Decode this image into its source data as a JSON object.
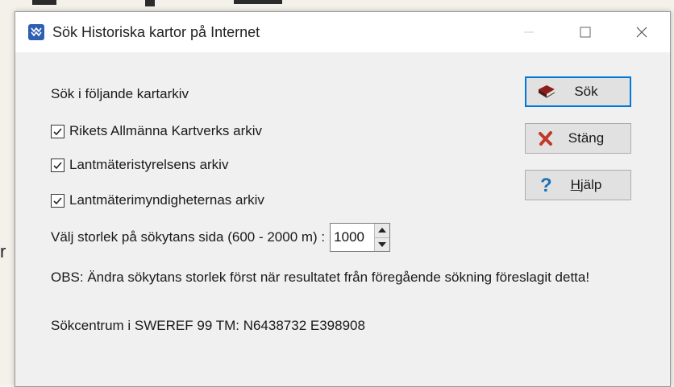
{
  "window": {
    "title": "Sök Historiska kartor på Internet"
  },
  "dialog": {
    "section_label": "Sök i följande kartarkiv",
    "archives": [
      {
        "label": "Rikets Allmänna Kartverks arkiv",
        "checked": true
      },
      {
        "label": "Lantmäteristyrelsens arkiv",
        "checked": true
      },
      {
        "label": "Lantmäterimyndigheternas arkiv",
        "checked": true
      }
    ],
    "size_label": "Välj storlek på sökytans sida (600 - 2000 m) :",
    "size_value": "1000",
    "obs_text": "OBS: Ändra sökytans storlek först när resultatet från föregående sökning föreslagit detta!",
    "center_text": "Sökcentrum i SWEREF 99 TM:  N6438732 E398908"
  },
  "buttons": {
    "search": {
      "label": "Sök",
      "icon": "book-icon"
    },
    "close": {
      "label": "Stäng",
      "icon": "red-x-icon"
    },
    "help": {
      "label_first": "H",
      "label_rest": "jälp",
      "icon": "question-icon"
    }
  },
  "background": {
    "left_text": "r"
  },
  "colors": {
    "accent": "#0078d7",
    "close_icon": "#c0392b",
    "help_icon": "#1f6fb5",
    "book_icon": "#8b1d1d"
  }
}
